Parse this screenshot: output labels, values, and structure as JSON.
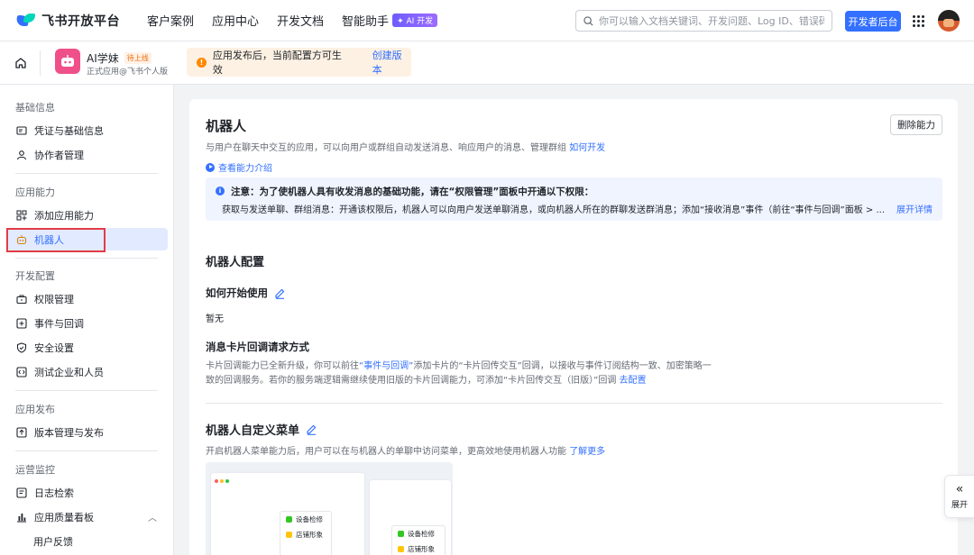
{
  "topnav": {
    "logo_text": "飞书开放平台",
    "links": [
      "客户案例",
      "应用中心",
      "开发文档",
      "智能助手"
    ],
    "ai_badge": "✦ AI 开发",
    "search_placeholder": "你可以输入文档关键词、开发问题、Log ID、错误码",
    "dev_console_button": "开发者后台"
  },
  "appbar": {
    "app_name": "AI学妹",
    "app_status": "待上线",
    "app_subtitle": "正式应用@飞书个人版",
    "notice_text": "应用发布后，当前配置方可生效",
    "notice_link": "创建版本"
  },
  "sidebar": {
    "sections": [
      {
        "title": "基础信息",
        "items": [
          "凭证与基础信息",
          "协作者管理"
        ]
      },
      {
        "title": "应用能力",
        "items": [
          "添加应用能力",
          "机器人"
        ]
      },
      {
        "title": "开发配置",
        "items": [
          "权限管理",
          "事件与回调",
          "安全设置",
          "测试企业和人员"
        ]
      },
      {
        "title": "应用发布",
        "items": [
          "版本管理与发布"
        ]
      },
      {
        "title": "运营监控",
        "items": [
          "日志检索",
          "应用质量看板",
          "用户反馈"
        ]
      }
    ],
    "active_item": "机器人"
  },
  "main": {
    "title": "机器人",
    "description": "与用户在聊天中交互的应用，可以向用户或群组自动发送消息、响应用户的消息、管理群组",
    "how_to_develop": "如何开发",
    "delete_button": "删除能力",
    "intro_link": "查看能力介绍",
    "tip": {
      "title": "注意：为了使机器人具有收发消息的基础功能，请在“权限管理”面板中开通以下权限：",
      "body": "获取与发送单聊、群组消息：开通该权限后，机器人可以向用户发送单聊消息，或向机器人所在的群聊发送群消息；添加“接收消息”事件（前往“事件与回调”面板 > ...",
      "more": "展开详情"
    },
    "config_title": "机器人配置",
    "how_to_start_label": "如何开始使用",
    "how_to_start_value": "暂无",
    "card_callback_title": "消息卡片回调请求方式",
    "card_callback_text_1": "卡片回调能力已全新升级，你可以前往",
    "card_callback_link_1": "“事件与回调”",
    "card_callback_text_2": "添加卡片的“卡片回传交互”回调，以接收与事件订阅结构一致、加密策略一致的回调服务。若你的服务端逻辑需继续使用旧版的卡片回调能力，可添加“卡片回传交互（旧版）”回调 ",
    "card_callback_link_2": "去配置",
    "menu_title": "机器人自定义菜单",
    "menu_desc": "开启机器人菜单能力后，用户可以在与机器人的单聊中访问菜单，更高效地使用机器人功能 ",
    "menu_learn_more": "了解更多",
    "preview_menu_items": [
      "设备检修",
      "店铺形象"
    ]
  },
  "expand_button": "展开",
  "colors": {
    "accent": "#3370ff",
    "active_bg": "#e1eaff",
    "highlight_box": "#e23b45",
    "warning": "#ff8800"
  }
}
